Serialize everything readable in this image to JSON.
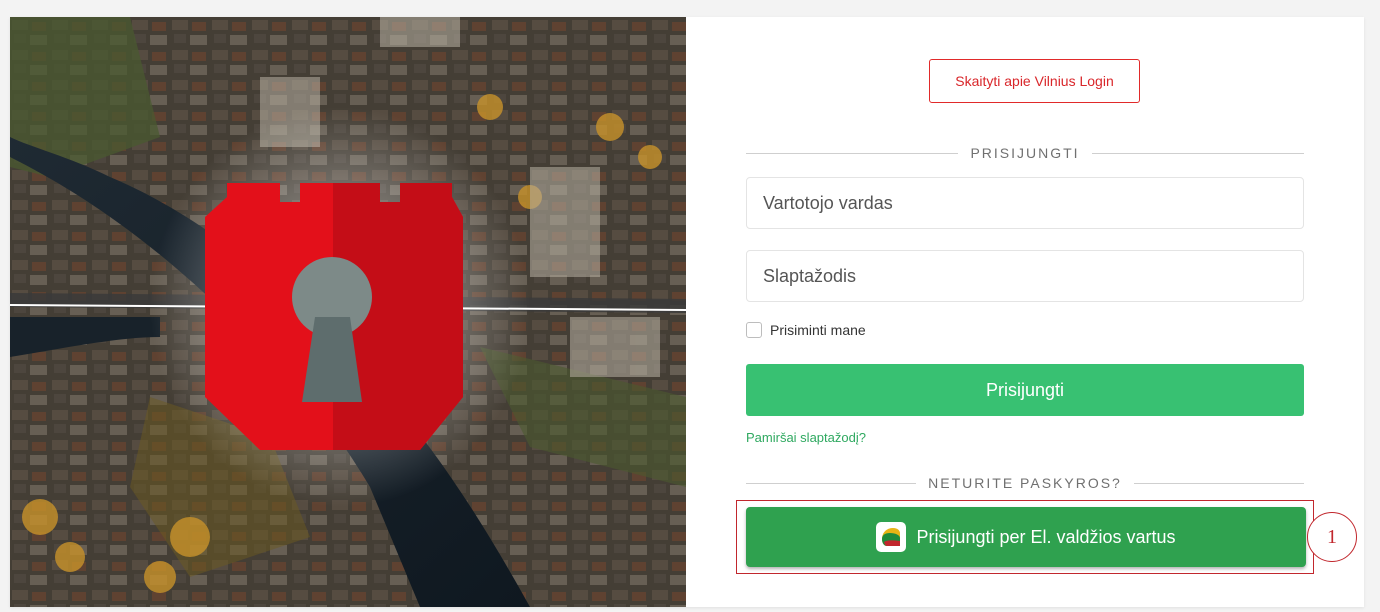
{
  "about_button": {
    "label": "Skaityti apie Vilnius Login"
  },
  "login": {
    "section_title": "PRISIJUNGTI",
    "username": {
      "placeholder": "Vartotojo vardas",
      "value": ""
    },
    "password": {
      "placeholder": "Slaptažodis",
      "value": ""
    },
    "remember_label": "Prisiminti mane",
    "remember_checked": false,
    "submit_label": "Prisijungti",
    "forgot_label": "Pamiršai slaptažodį?"
  },
  "register": {
    "section_title": "NETURITE PASKYROS?",
    "gov_button_label": "Prisijungti per El. valdžios vartus",
    "gov_icon": "lithuania-egov-icon"
  },
  "annotation": {
    "marker_label": "1"
  },
  "colors": {
    "brand_red": "#d9262a",
    "primary_green": "#38c172",
    "gov_green": "#2fa14f",
    "link_green": "#2fa960",
    "annotation_red": "#c1272d"
  },
  "hero": {
    "logo": "vilnius-keyhole-logo-icon"
  }
}
